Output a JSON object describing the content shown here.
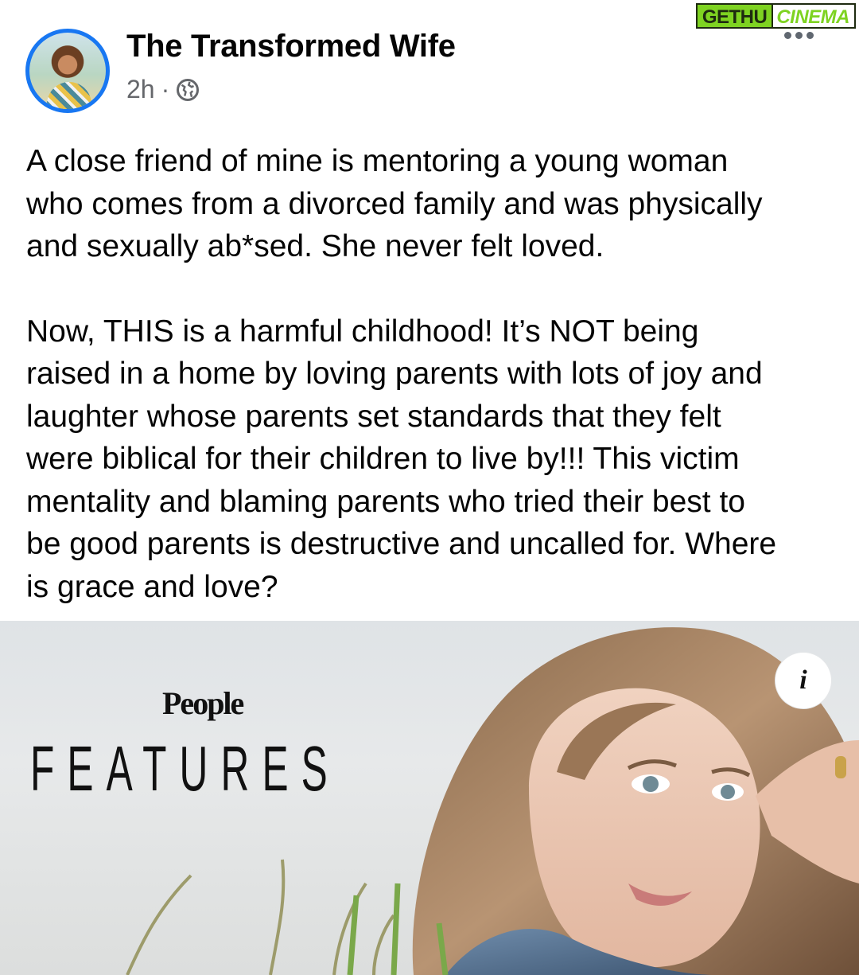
{
  "post": {
    "author": "The Transformed Wife",
    "time": "2h",
    "separator": "·",
    "paragraphs": [
      "A close friend of mine is mentoring a young woman\nwho comes from a divorced family and was physically\nand sexually ab*sed. She never felt loved.",
      "Now, THIS is a harmful childhood! It’s NOT being\nraised in a home by loving parents with lots of joy and\nlaughter whose parents set standards that they felt\nwere biblical for their children to live by!!! This victim\nmentality and blaming parents who tried their best to\nbe good parents is destructive and uncalled for. Where\nis grace and love?"
    ]
  },
  "watermark": {
    "part1": "GETHU",
    "part2": "CINEMA"
  },
  "link_preview": {
    "brand": "People",
    "section": "FEATURES",
    "info_label": "i"
  },
  "icons": {
    "privacy": "globe-icon",
    "menu": "more-options-icon",
    "info": "info-icon"
  },
  "colors": {
    "accent": "#1877f2",
    "secondary_text": "#65676b",
    "watermark_green": "#7ed321"
  }
}
